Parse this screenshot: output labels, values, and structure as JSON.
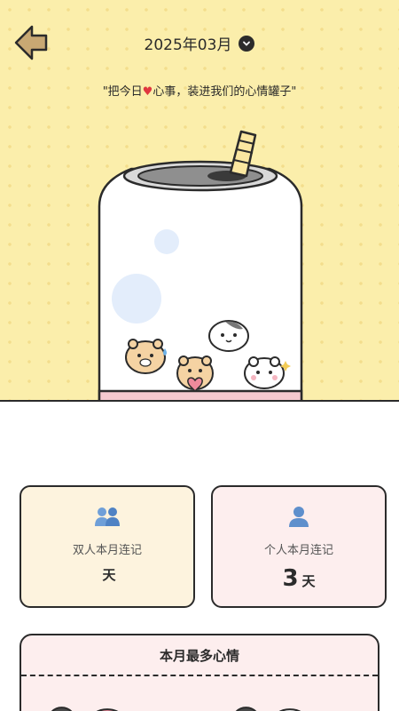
{
  "header": {
    "month": "2025年03月",
    "slogan_before": "\"把今日",
    "slogan_heart": "♥",
    "slogan_after": "心事，装进我们的心情罐子\""
  },
  "stats": {
    "couple": {
      "label": "双人本月连记",
      "value": "",
      "unit": "天"
    },
    "personal": {
      "label": "个人本月连记",
      "value": "3",
      "unit": "天"
    }
  },
  "mood": {
    "title": "本月最多心情"
  },
  "colors": {
    "background": "#fbeeab",
    "card_left": "#fdf3de",
    "card_right": "#fdeeee",
    "can_band": "#f5c9cf",
    "back_button": "#c8a873"
  }
}
